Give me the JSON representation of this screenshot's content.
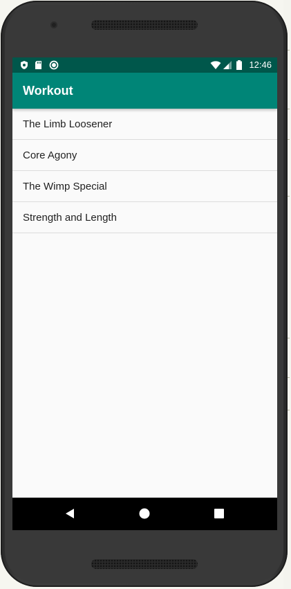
{
  "status_bar": {
    "time": "12:46",
    "left_icons": [
      "shield-icon",
      "sd-card-icon",
      "circle-icon"
    ],
    "right_icons": [
      "wifi-icon",
      "cell-signal-icon",
      "battery-icon"
    ]
  },
  "app_bar": {
    "title": "Workout"
  },
  "workout_list": [
    {
      "label": "The Limb Loosener"
    },
    {
      "label": "Core Agony"
    },
    {
      "label": "The Wimp Special"
    },
    {
      "label": "Strength and Length"
    }
  ],
  "nav_bar": {
    "buttons": [
      "back-icon",
      "home-icon",
      "recents-icon"
    ]
  },
  "colors": {
    "status_bar": "#00574b",
    "app_bar": "#008577",
    "background": "#fafafa",
    "nav_bar": "#000000"
  }
}
